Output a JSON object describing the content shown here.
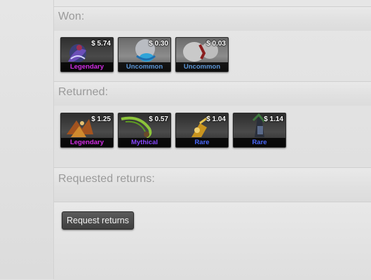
{
  "sections": {
    "won": {
      "title": "Won:",
      "items": [
        {
          "price": "$ 5.74",
          "rarity": "Legendary",
          "rarity_color": "#d32ce6"
        },
        {
          "price": "$ 0.30",
          "rarity": "Uncommon",
          "rarity_color": "#5e98d9"
        },
        {
          "price": "$ 0.03",
          "rarity": "Uncommon",
          "rarity_color": "#5e98d9"
        }
      ]
    },
    "returned": {
      "title": "Returned:",
      "items": [
        {
          "price": "$ 1.25",
          "rarity": "Legendary",
          "rarity_color": "#d32ce6"
        },
        {
          "price": "$ 0.57",
          "rarity": "Mythical",
          "rarity_color": "#8847ff"
        },
        {
          "price": "$ 1.04",
          "rarity": "Rare",
          "rarity_color": "#4b69ff"
        },
        {
          "price": "$ 1.14",
          "rarity": "Rare",
          "rarity_color": "#4b69ff"
        }
      ]
    },
    "requested": {
      "title": "Requested returns:"
    }
  },
  "actions": {
    "request_returns_label": "Request returns"
  }
}
